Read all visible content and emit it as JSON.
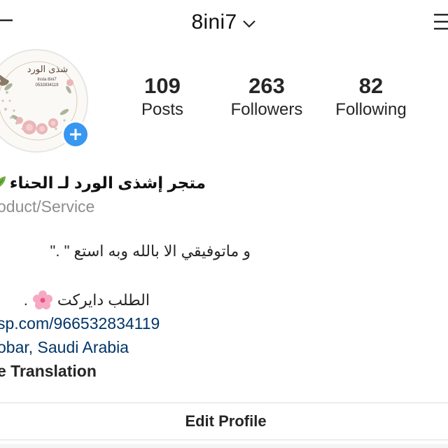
{
  "header": {
    "username": "8ini7",
    "back_icon": "back-arrow-icon",
    "dropdown_icon": "chevron-down-icon",
    "menu_icon": "hamburger-menu-icon"
  },
  "avatar": {
    "title": "شذى الورد",
    "line1": "Insta 8ini7",
    "line2": "0532834119",
    "add_icon": "plus-icon"
  },
  "stats": [
    {
      "value": "109",
      "label": "Posts"
    },
    {
      "value": "263",
      "label": "Followers"
    },
    {
      "value": "82",
      "label": "Following"
    }
  ],
  "bio": {
    "name": "متجر إشذى الورد لـ الحناء",
    "name_icon": "leaf-icon",
    "category": "oduct/Service",
    "line1": "و ماتوفيقي الا بالله وبه استع \" .\"",
    "line2": "الطلب دايركت",
    "line2_icon": "cherry-blossom-icon",
    "line2_suffix": ".",
    "link": "sp.com/966532834119",
    "location": "obar, Saudi Arabia",
    "translation": "e Translation"
  },
  "actions": {
    "edit_profile": "Edit Profile"
  },
  "colors": {
    "accent_blue": "#3897f0",
    "link_blue": "#003569",
    "secondary_text": "#8e8e8e",
    "border": "#dbdbdb"
  }
}
